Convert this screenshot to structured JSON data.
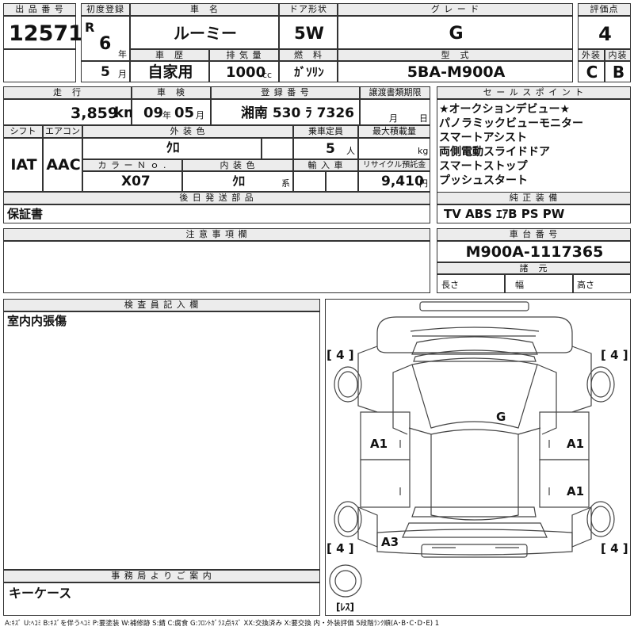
{
  "top": {
    "lot_no_label": "出 品 番 号",
    "lot_no": "12571",
    "first_reg_label": "初度登録",
    "era": "R",
    "year_num": "6",
    "year_unit": "年",
    "month_num": "5",
    "month_unit": "月",
    "car_name_label": "車　名",
    "car_name": "ルーミー",
    "door_label": "ドア形状",
    "door": "5W",
    "grade_label": "グ レ ー ド",
    "grade": "G",
    "score_label": "評価点",
    "score": "4",
    "history_label": "車　歴",
    "history": "自家用",
    "displacement_label": "排 気 量",
    "displacement": "1000",
    "displacement_unit": "cc",
    "fuel_label": "燃　料",
    "fuel": "ｶﾞｿﾘﾝ",
    "model_label": "型　式",
    "model": "5BA-M900A",
    "ext_label": "外装",
    "ext": "C",
    "int_label": "内装",
    "int": "B"
  },
  "mid": {
    "mileage_label": "走　行",
    "mileage": "3,859",
    "mileage_unit": "km",
    "inspection_label": "車　検",
    "insp_year": "09",
    "insp_year_unit": "年",
    "insp_month": "05",
    "insp_month_unit": "月",
    "plate_label": "登 録 番 号",
    "plate": "湘南 530 ﾗ 7326",
    "transfer_label": "譲渡書類期限",
    "transfer_month": "月",
    "transfer_day": "日",
    "sales_label": "セ ー ル ス ポ イ ン ト",
    "sales_points": [
      "★オークションデビュー★",
      "パノラミックビューモニター",
      "スマートアシスト",
      "両側電動スライドドア",
      "スマートストップ",
      "プッシュスタート"
    ],
    "shift_label": "シフト",
    "shift": "IAT",
    "aircon_label": "エアコン",
    "aircon": "AAC",
    "ext_color_label": "外 装 色",
    "ext_color": "ｸﾛ",
    "capacity_label": "乗車定員",
    "capacity": "5",
    "capacity_unit": "人",
    "max_load_label": "最大積載量",
    "max_load_unit": "kg",
    "color_no_label": "カ ラ ー Ｎ ｏ .",
    "color_no": "X07",
    "int_color_label": "内 装 色",
    "int_color": "ｸﾛ",
    "int_color_unit": "系",
    "import_label": "輸 入 車",
    "recycle_label": "リサイクル預託金",
    "recycle": "9,410",
    "recycle_unit": "円",
    "later_label": "後 日 発 送 部 品",
    "later": "保証書",
    "equip_label": "純 正 装 備",
    "equip": "TV  ABS  ｴｱB  PS  PW",
    "notes_label": "注 意 事 項 欄",
    "chassis_label": "車 台 番 号",
    "chassis": "M900A-1117365",
    "spec_label": "諸　元",
    "length_label": "長さ",
    "width_label": "幅",
    "height_label": "高さ"
  },
  "bottom": {
    "inspector_label": "検 査 員 記 入 欄",
    "inspector_note": "室内内張傷",
    "office_label": "事 務 局 よ り ご 案 内",
    "office_note": "キーケース",
    "legend": "A:ｷｽﾞ U:ﾍｺﾐ B:ｷｽﾞを伴うﾍｺﾐ P:要塗装 W:補修跡 S:錆 C:腐食 G:ﾌﾛﾝﾄｶﾞﾗｽ点ｷｽﾞ XX:交換済み X:要交換 内・外装評価 5段階ﾗﾝｸ順(A･B･C･D･E) 1"
  },
  "diagram": {
    "tire_fl": "[ 4 ]",
    "tire_fr": "[ 4 ]",
    "tire_rl": "[ 4 ]",
    "tire_rr": "[ 4 ]",
    "spare": "[ﾚｽ]",
    "mark_glass": "G",
    "mark_left_front": "A1",
    "mark_right_front": "A1",
    "mark_right_rear": "A1",
    "mark_left_rear": "A3"
  }
}
